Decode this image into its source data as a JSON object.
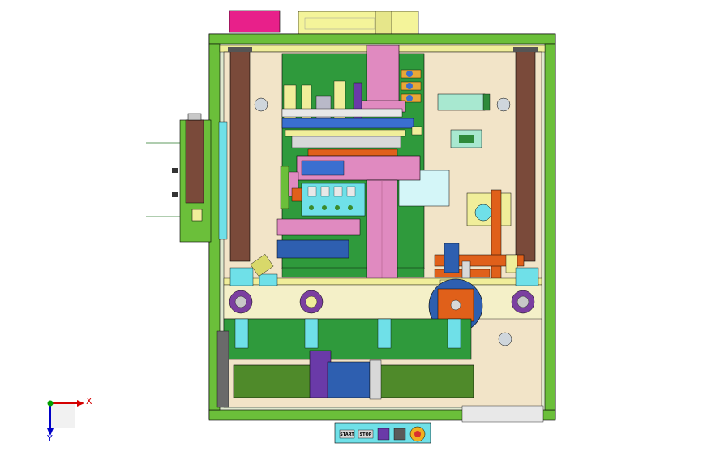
{
  "view": {
    "background": "#ffffff",
    "axes": {
      "x_label": "X",
      "y_label": "Y",
      "x_color": "#d40000",
      "y_color": "#0000c8",
      "origin_color": "#00a000"
    }
  },
  "control_panel": {
    "buttons": [
      {
        "label": "START",
        "icon": "start-button"
      },
      {
        "label": "STOP",
        "icon": "stop-button"
      },
      {
        "label": "",
        "icon": "reset-icon"
      },
      {
        "label": "",
        "icon": "mode-switch-icon"
      },
      {
        "label": "",
        "icon": "emergency-stop-icon"
      }
    ]
  },
  "palette": {
    "frame_green": "#6bbf3a",
    "base_plate": "#f2e4c8",
    "pcb_green": "#2f9a3c",
    "rail_brown": "#7a4a3a",
    "slide_pink": "#e08ac0",
    "motor_green": "#4f8a2a",
    "carriage_blue": "#2e5fb0",
    "cylinder_orange": "#e0601a",
    "turntable_purple": "#7b3fa0",
    "tray_yellow": "#f0ee9a",
    "cyan_block": "#6fe0e8",
    "magenta_box": "#e8208a"
  }
}
